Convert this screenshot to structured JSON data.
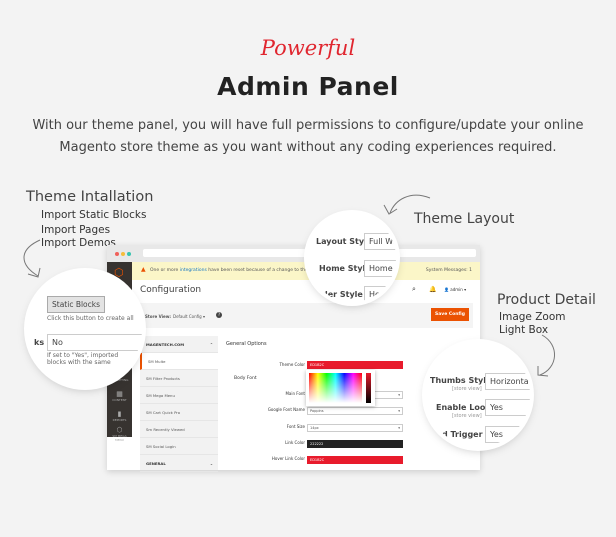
{
  "hero": {
    "script": "Powerful",
    "title": "Admin Panel",
    "description": "With our theme panel, you will have full permissions to configure/update your online Magento store theme as you want without any coding experiences required."
  },
  "callouts": {
    "install": {
      "title": "Theme Intallation",
      "items": [
        "Import Static Blocks",
        "Import Pages",
        "Import Demos"
      ]
    },
    "layout": {
      "title": "Theme Layout"
    },
    "product": {
      "title": "Product Detail",
      "items": [
        "Image Zoom",
        "Light Box"
      ]
    }
  },
  "admin": {
    "warning_prefix": "One or more ",
    "warning_link": "integrations",
    "warning_suffix": " have been reset because of a change to their xml co...",
    "system_messages": "System Messages: 1",
    "page_title": "Configuration",
    "user": "admin",
    "notification_count": "1",
    "store_view_label": "Store View:",
    "store_view_value": "Default Config",
    "save_label": "Save Config",
    "menu_header": "MAGENTECH.COM",
    "menu_items": [
      "SM Multe",
      "SM Filter Products",
      "SM Mega Menu",
      "SM Cart Quick Pro",
      "Sm Recently Viewed",
      "SM Social Login"
    ],
    "menu_footer": "GENERAL",
    "section": "General Options",
    "body_font": "Body Font",
    "scope": "[store view]",
    "fields": {
      "theme_color": {
        "label": "Theme Color",
        "value": "ED1B2C"
      },
      "main_font": {
        "label": "Main Font",
        "value": ""
      },
      "google_font": {
        "label": "Google Font Name",
        "value": "Poppins"
      },
      "font_size": {
        "label": "Font Size",
        "value": "14px"
      },
      "link_color": {
        "label": "Link Color",
        "value": "222222"
      },
      "hover_link_color": {
        "label": "Hover Link Color",
        "value": "ED1B2C"
      }
    },
    "nav": [
      "DASHBOARD",
      "SALES",
      "PRODUCTS",
      "CUSTOMERS",
      "MARKETING",
      "CONTENT",
      "REPORTS",
      "SM MEGA MENU"
    ]
  },
  "zoom_install": {
    "button": "Static Blocks",
    "hint": "Click this button to create all",
    "label": "ks",
    "select": "No",
    "note": "If set to \"Yes\", imported blocks with the same"
  },
  "zoom_layout": {
    "rows": [
      {
        "label": "Layout Style",
        "value": "Full Wi"
      },
      {
        "label": "Home Style",
        "value": "Home St"
      },
      {
        "label": "der Style",
        "value": "Hea"
      }
    ]
  },
  "zoom_product": {
    "rows": [
      {
        "label": "Thumbs Styles",
        "value": "Horizontal"
      },
      {
        "label": "Enable Loop",
        "value": "Yes"
      },
      {
        "label": "rd Trigger",
        "value": "Yes"
      }
    ],
    "scope": "[store view]"
  },
  "colors": {
    "accent": "#e0262f",
    "save": "#eb5202",
    "theme": "#ED1B2C"
  }
}
